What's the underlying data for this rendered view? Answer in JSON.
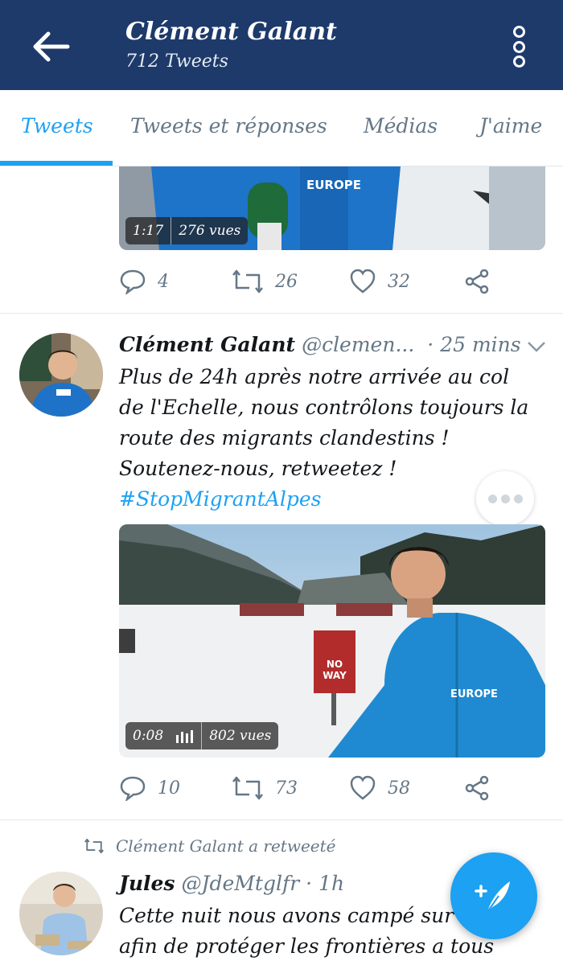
{
  "header": {
    "title": "Clément Galant",
    "subtitle": "712 Tweets",
    "back_icon": "arrow-left-icon",
    "more_icon": "vertical-dots-icon"
  },
  "tabs": [
    {
      "label": "Tweets",
      "active": true
    },
    {
      "label": "Tweets et réponses",
      "active": false
    },
    {
      "label": "Médias",
      "active": false
    },
    {
      "label": "J'aime",
      "active": false
    }
  ],
  "tweet0": {
    "video": {
      "duration": "1:17",
      "views": "276 vues",
      "overlay_text": "EUROPE"
    },
    "actions": {
      "replies": "4",
      "retweets": "26",
      "likes": "32"
    }
  },
  "tweet1": {
    "name": "Clément Galant",
    "handle": "@clemen...",
    "time": "· 25 mins",
    "text_lines": [
      "Plus de 24h après notre arrivée au col",
      "de l'Echelle, nous contrôlons toujours la",
      "route des migrants clandestins !",
      "Soutenez-nous, retweetez !"
    ],
    "hashtag": "#StopMigrantAlpes",
    "video": {
      "duration": "0:08",
      "views": "802 vues",
      "sign_text": "NO WAY",
      "jacket_text": "EUROPE"
    },
    "actions": {
      "replies": "10",
      "retweets": "73",
      "likes": "58"
    }
  },
  "retweet_label": "Clément Galant a retweeté",
  "tweet2": {
    "name": "Jules",
    "handle": "@JdeMtglfr",
    "time": "· 1h",
    "text_lines": [
      "Cette nuit nous avons campé sur",
      "afin de protéger les frontières a tous"
    ]
  },
  "colors": {
    "header_bg": "#1d3a6b",
    "accent": "#1da1f2",
    "muted": "#657786"
  }
}
